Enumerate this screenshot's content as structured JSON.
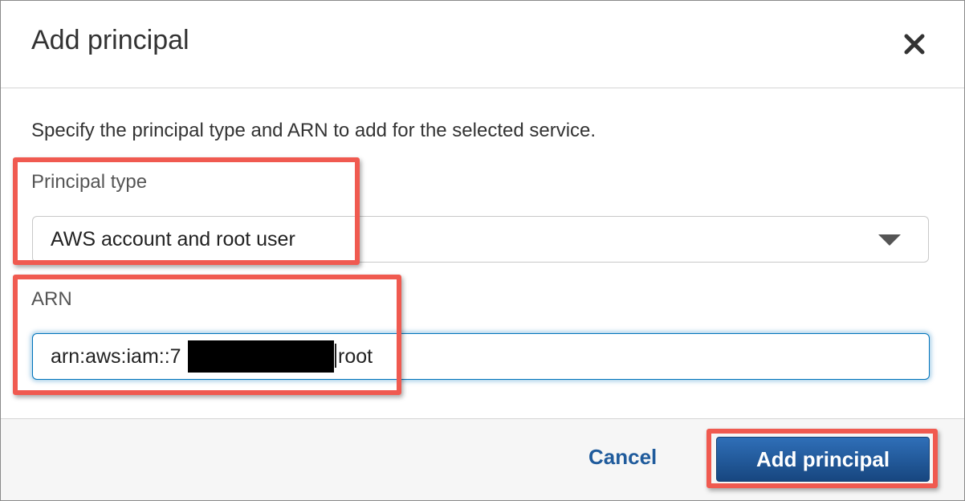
{
  "dialog": {
    "title": "Add principal",
    "description": "Specify the principal type and ARN to add for the selected service."
  },
  "principal_type": {
    "label": "Principal type",
    "selected": "AWS account and root user"
  },
  "arn": {
    "label": "ARN",
    "value_prefix": "arn:aws:iam::7",
    "value_suffix": "root"
  },
  "footer": {
    "cancel_label": "Cancel",
    "submit_label": "Add principal"
  },
  "icons": {
    "close": "close-icon",
    "dropdown": "chevron-down-icon"
  },
  "colors": {
    "accent": "#0073bb",
    "link": "#1f5b9c",
    "primary_button": "#1f5fa8",
    "highlight": "#f05a50",
    "redaction": "#000000"
  }
}
